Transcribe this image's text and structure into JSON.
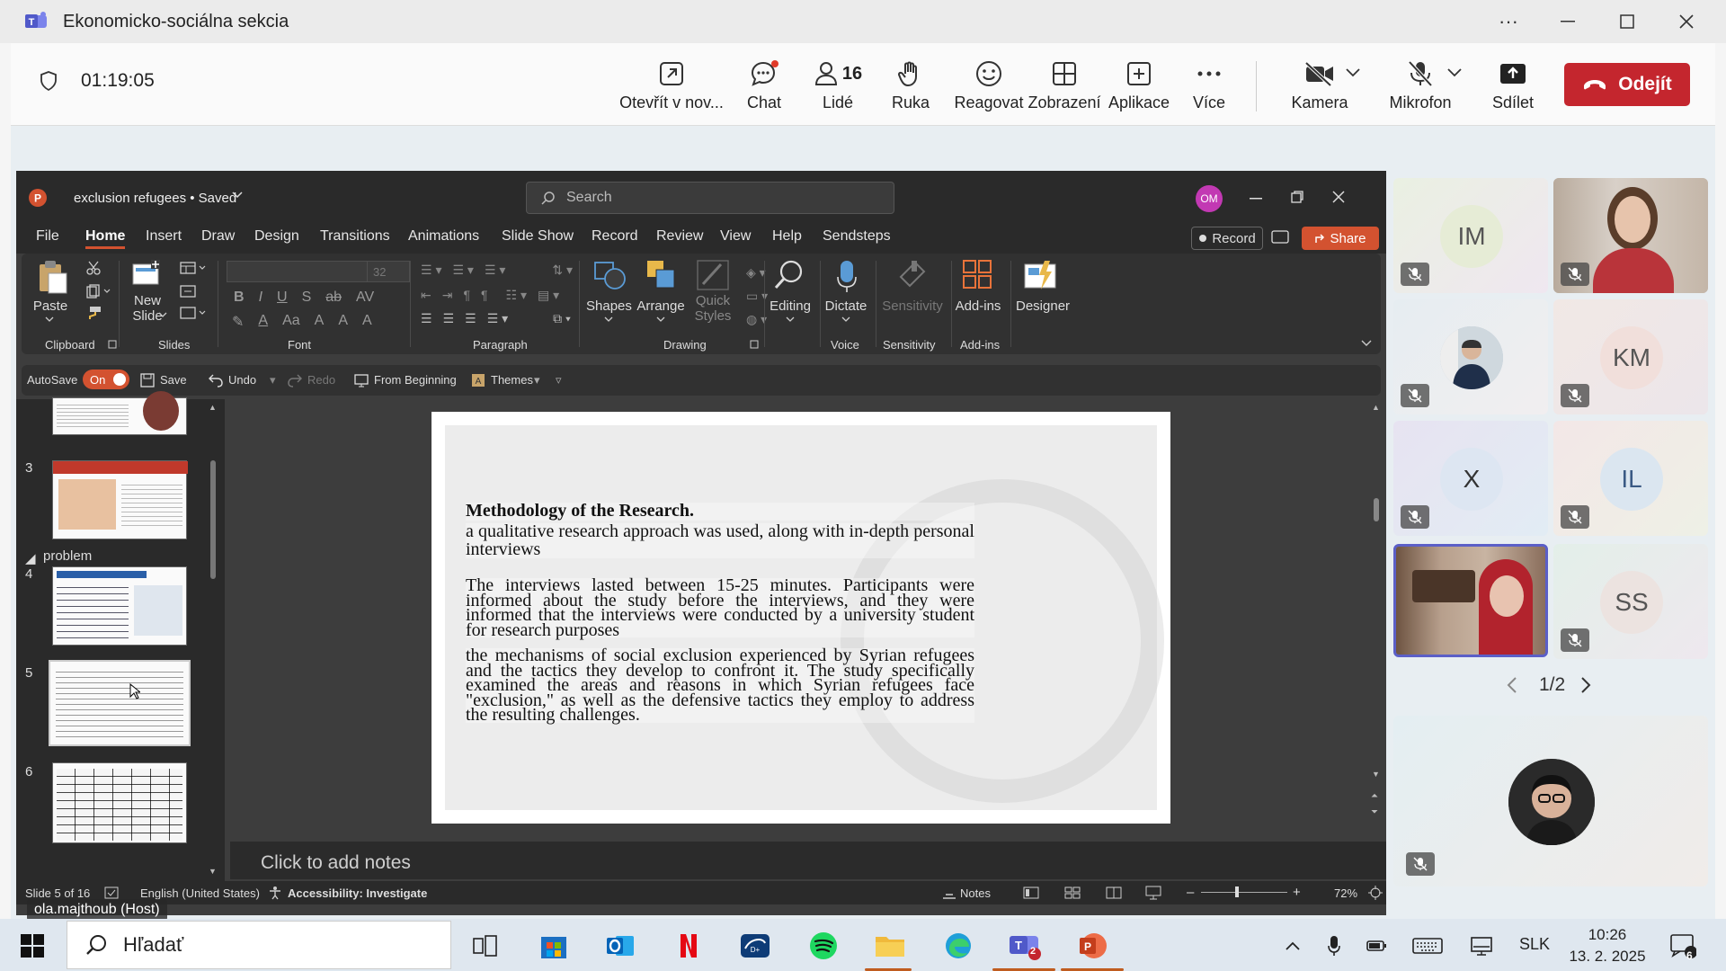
{
  "teams": {
    "window_title": "Ekonomicko-sociálna sekcia",
    "timer": "01:19:05",
    "buttons": {
      "open_new": "Otevřít v nov...",
      "chat": "Chat",
      "people": "Lidé",
      "people_count": "16",
      "raise_hand": "Ruka",
      "react": "Reagovat",
      "view": "Zobrazení",
      "apps": "Aplikace",
      "more": "Více",
      "camera": "Kamera",
      "mic": "Mikrofon",
      "share": "Sdílet",
      "leave": "Odejít"
    },
    "host_label": "ola.majthoub (Host)",
    "pager": "1/2",
    "participants": [
      {
        "initials": "IM",
        "bg": "#e8eedd",
        "circle": "#e6ecd6"
      },
      {
        "initials": "",
        "bg": "#d8d2cc",
        "circle": ""
      },
      {
        "initials": "",
        "bg": "#e9edf0",
        "circle": ""
      },
      {
        "initials": "KM",
        "bg": "#f0e6e4",
        "circle": "#f1dfdb"
      },
      {
        "initials": "X",
        "bg": "#e3e8f0",
        "circle": "#dde6f2"
      },
      {
        "initials": "IL",
        "bg": "#f0eadf",
        "circle": "#dbe6f0"
      },
      {
        "initials": "",
        "bg": "#9a7d6e",
        "circle": ""
      },
      {
        "initials": "SS",
        "bg": "#e4ece8",
        "circle": "#ece3e0"
      }
    ]
  },
  "ppt": {
    "file_title": "exclusion refugees • Saved",
    "avatar": "OM",
    "search_placeholder": "Search",
    "menu": [
      "File",
      "Home",
      "Insert",
      "Draw",
      "Design",
      "Transitions",
      "Animations",
      "Slide Show",
      "Record",
      "Review",
      "View",
      "Help",
      "Sendsteps"
    ],
    "record_label": "Record",
    "share_label": "Share",
    "ribbon": {
      "paste": "Paste",
      "new_slide": "New Slide",
      "font_size": "32",
      "shapes": "Shapes",
      "arrange": "Arrange",
      "quick_styles": "Quick Styles",
      "editing": "Editing",
      "dictate": "Dictate",
      "sensitivity": "Sensitivity",
      "addins": "Add-ins",
      "designer": "Designer",
      "groups": {
        "clipboard": "Clipboard",
        "slides": "Slides",
        "font": "Font",
        "paragraph": "Paragraph",
        "drawing": "Drawing",
        "voice": "Voice",
        "sensitivity": "Sensitivity",
        "addins": "Add-ins"
      }
    },
    "qat": {
      "autosave": "AutoSave",
      "toggle": "On",
      "save": "Save",
      "undo": "Undo",
      "redo": "Redo",
      "from_beginning": "From Beginning",
      "themes": "Themes"
    },
    "thumbs": {
      "n3": "3",
      "section": "problem",
      "n4": "4",
      "n5": "5",
      "n6": "6"
    },
    "slide": {
      "title": "Methodology of the Research.",
      "p1": "a qualitative research approach was used, along with in-depth personal interviews",
      "p2": "The interviews lasted between 15-25 minutes. Participants were informed about the study before the interviews, and they were informed that the interviews were conducted by a university student for research purposes",
      "p3": "the mechanisms of social exclusion experienced by Syrian refugees and the tactics they develop to confront it. The study specifically examined the areas and reasons in which Syrian refugees face \"exclusion,\" as well as the defensive tactics they employ to address the resulting challenges."
    },
    "notes_placeholder": "Click to add notes",
    "status": {
      "slide": "Slide 5 of 16",
      "language": "English (United States)",
      "accessibility": "Accessibility: Investigate",
      "notes": "Notes",
      "zoom": "72%"
    }
  },
  "taskbar": {
    "search_placeholder": "Hľadať",
    "lang": "SLK",
    "time": "10:26",
    "date": "13. 2. 2025",
    "notif": "6",
    "teams_badge": "2"
  }
}
